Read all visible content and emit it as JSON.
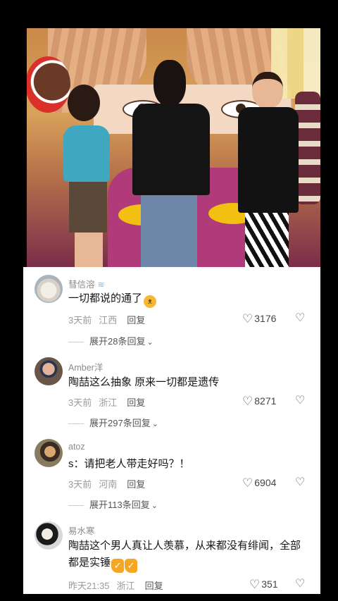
{
  "comments": [
    {
      "username": "彗信溶",
      "username_icon": "wave-badge-icon",
      "text": "一切都说的通了",
      "emoji": "cat-face-emoji",
      "time": "3天前",
      "location": "江西",
      "reply_label": "回复",
      "likes": "3176",
      "expand_label": "展开28条回复"
    },
    {
      "username": "Amber洋",
      "text": "陶喆这么抽象 原来一切都是遗传",
      "time": "3天前",
      "location": "浙江",
      "reply_label": "回复",
      "likes": "8271",
      "expand_label": "展开297条回复"
    },
    {
      "username": "atoz",
      "text": "s：请把老人带走好吗？！",
      "time": "3天前",
      "location": "河南",
      "reply_label": "回复",
      "likes": "6904",
      "expand_label": "展开113条回复"
    },
    {
      "username": "易水寒",
      "text": "陶喆这个男人真让人羡慕，从来都没有绯闻，全部都是实锤",
      "emoji": "thumbs-up-emoji",
      "time": "昨天21:35",
      "location": "浙江",
      "reply_label": "回复",
      "likes": "351"
    }
  ],
  "icons": {
    "like": "heart-outline-icon",
    "dislike": "broken-heart-icon",
    "expand": "chevron-down-icon"
  }
}
